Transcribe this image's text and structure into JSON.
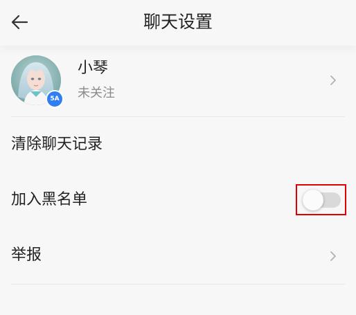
{
  "header": {
    "title": "聊天设置",
    "back_icon": "back-arrow-icon"
  },
  "profile": {
    "name": "小琴",
    "status": "未关注",
    "badge_text": "5A",
    "chevron_icon": "chevron-right-icon"
  },
  "rows": [
    {
      "label": "清除聊天记录"
    },
    {
      "label": "加入黑名单",
      "toggle_on": false
    },
    {
      "label": "举报",
      "chevron_icon": "chevron-right-icon"
    }
  ],
  "colors": {
    "background": "#f7f7f7",
    "text": "#222222",
    "secondary_text": "#8a8a8a",
    "toggle_off": "#d9d9d9",
    "highlight_box": "#e00000",
    "badge": "#2f7ff2"
  }
}
